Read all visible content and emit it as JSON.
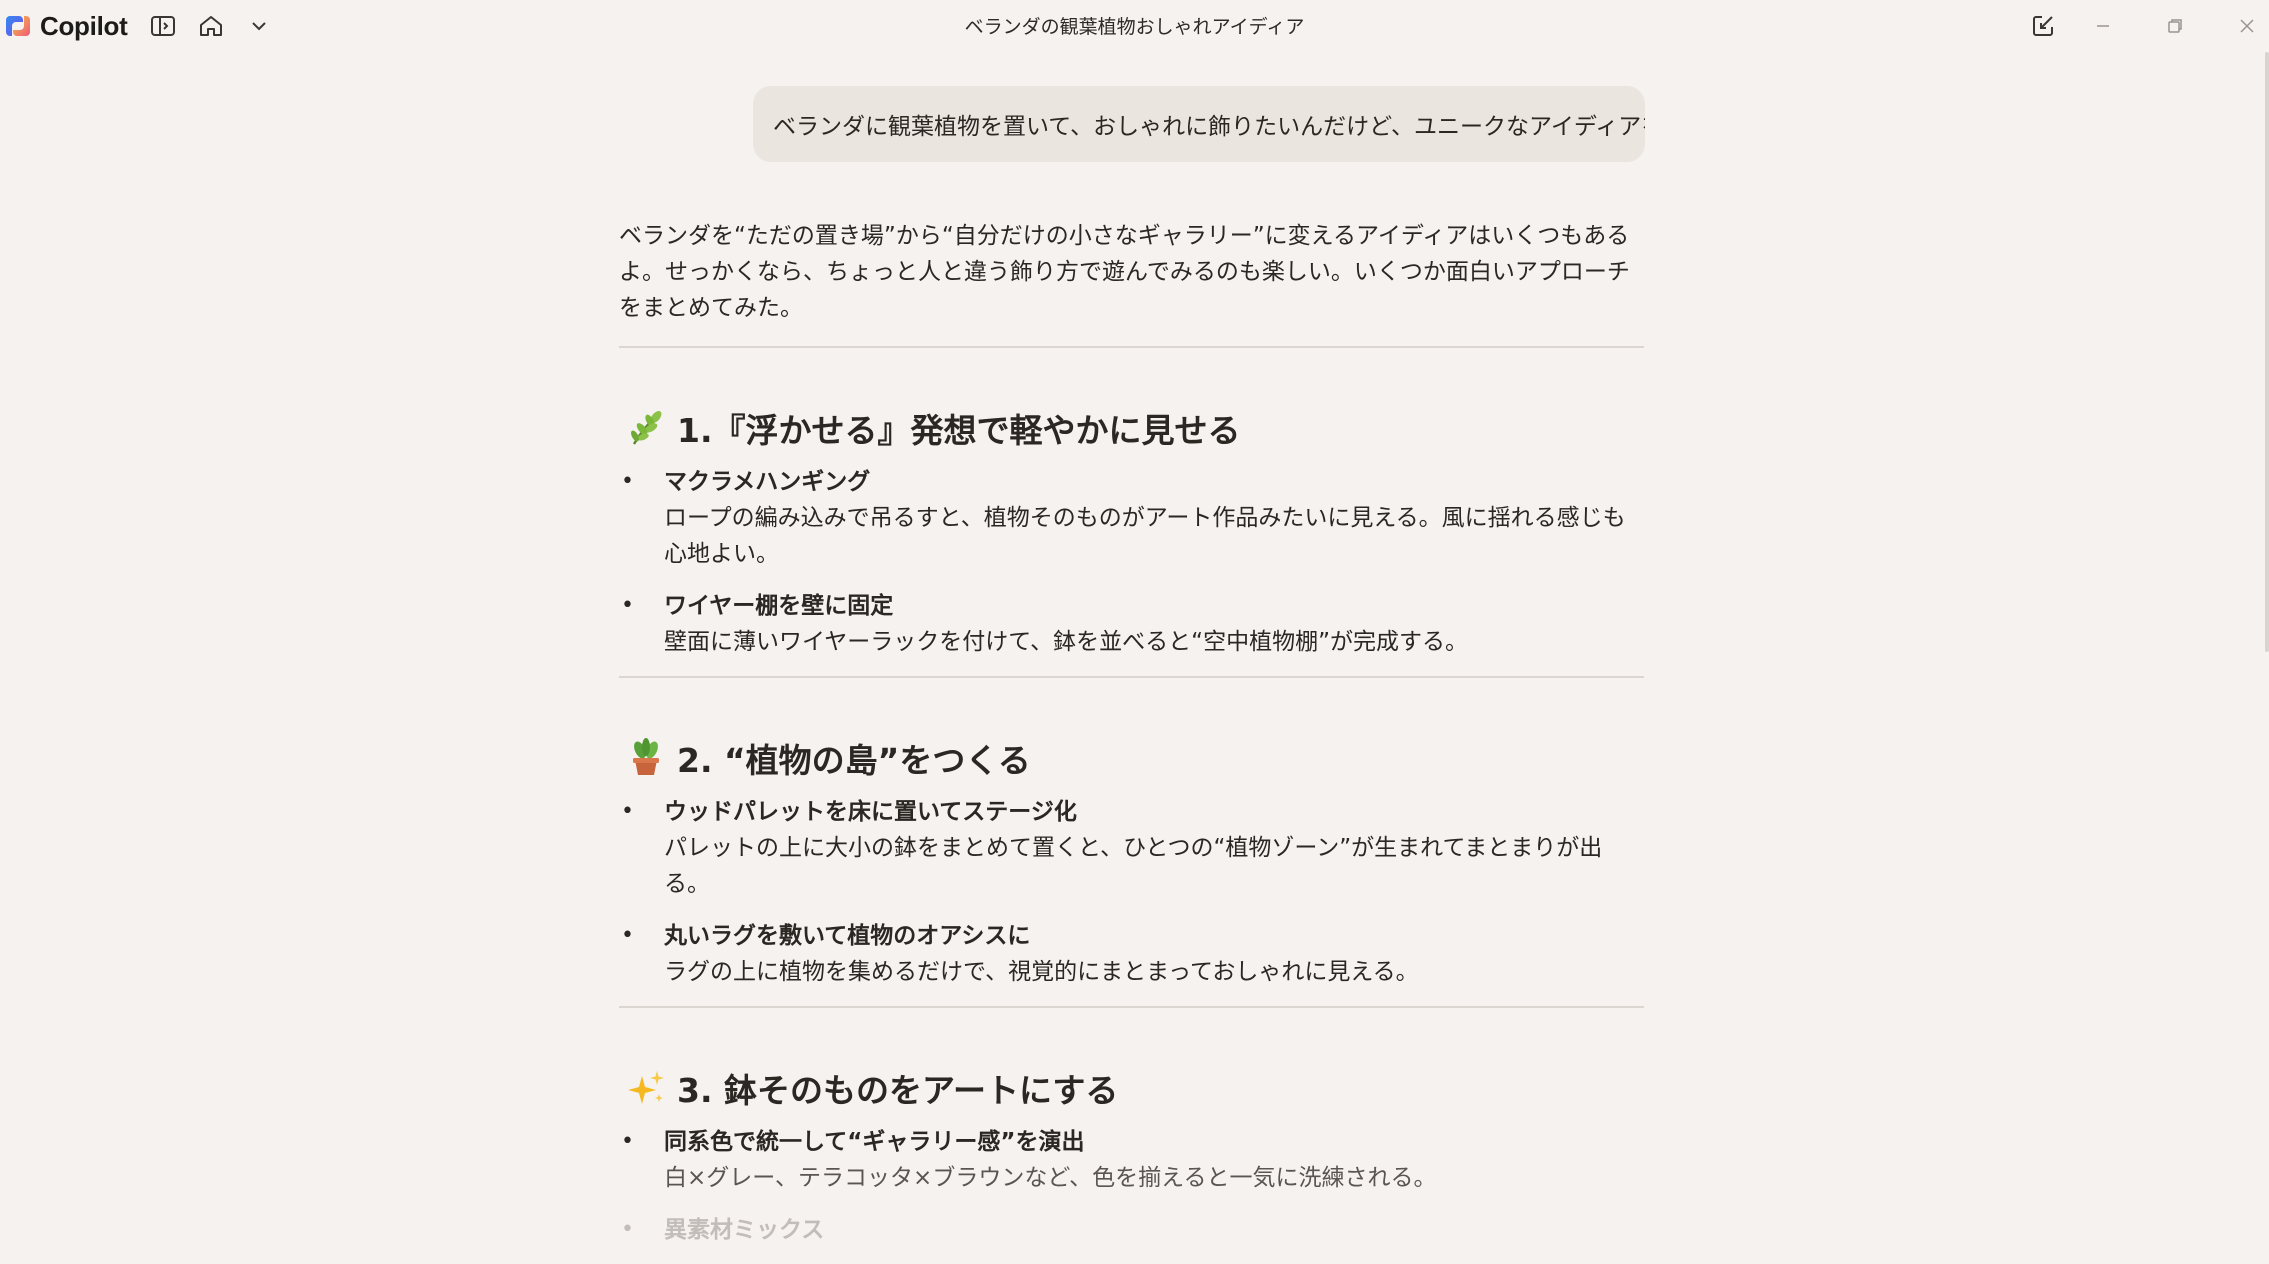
{
  "app": {
    "name": "Copilot",
    "window_title": "ベランダの観葉植物おしゃれアイディア"
  },
  "titlebar": {
    "icons": [
      "sidebar-toggle-icon",
      "home-icon",
      "chevron-down-icon"
    ],
    "right_icons": [
      "new-chat-icon",
      "minimize-icon",
      "restore-icon",
      "close-icon"
    ]
  },
  "conversation": {
    "user_message": "ベランダに観葉植物を置いて、おしゃれに飾りたいんだけど、ユニークなアイディアを教えて",
    "response": {
      "intro": "ベランダを“ただの置き場”から“自分だけの小さなギャラリー”に変えるアイディアはいくつもあるよ。せっかくなら、ちょっと人と違う飾り方で遊んでみるのも楽しい。いくつか面白いアプローチをまとめてみた。",
      "sections": [
        {
          "emoji": "herb",
          "title": "1.『浮かせる』発想で軽やかに見せる",
          "items": [
            {
              "title": "マクラメハンギング",
              "desc": "ロープの編み込みで吊るすと、植物そのものがアート作品みたいに見える。風に揺れる感じも心地よい。"
            },
            {
              "title": "ワイヤー棚を壁に固定",
              "desc": "壁面に薄いワイヤーラックを付けて、鉢を並べると“空中植物棚”が完成する。"
            }
          ]
        },
        {
          "emoji": "potted-plant",
          "title": "2. “植物の島”をつくる",
          "items": [
            {
              "title": "ウッドパレットを床に置いてステージ化",
              "desc": "パレットの上に大小の鉢をまとめて置くと、ひとつの“植物ゾーン”が生まれてまとまりが出る。"
            },
            {
              "title": "丸いラグを敷いて植物のオアシスに",
              "desc": "ラグの上に植物を集めるだけで、視覚的にまとまっておしゃれに見える。"
            }
          ]
        },
        {
          "emoji": "sparkles",
          "title": "3. 鉢そのものをアートにする",
          "items": [
            {
              "title": "同系色で統一して“ギャラリー感”を演出",
              "desc": "白×グレー、テラコッタ×ブラウンなど、色を揃えると一気に洗練される。"
            },
            {
              "title": "異素材ミックス",
              "desc": ""
            }
          ]
        }
      ]
    }
  },
  "colors": {
    "background": "#f5f2ef",
    "user_bubble": "#ebe5e0",
    "text": "#2b2723",
    "divider": "#dcd6d1"
  }
}
